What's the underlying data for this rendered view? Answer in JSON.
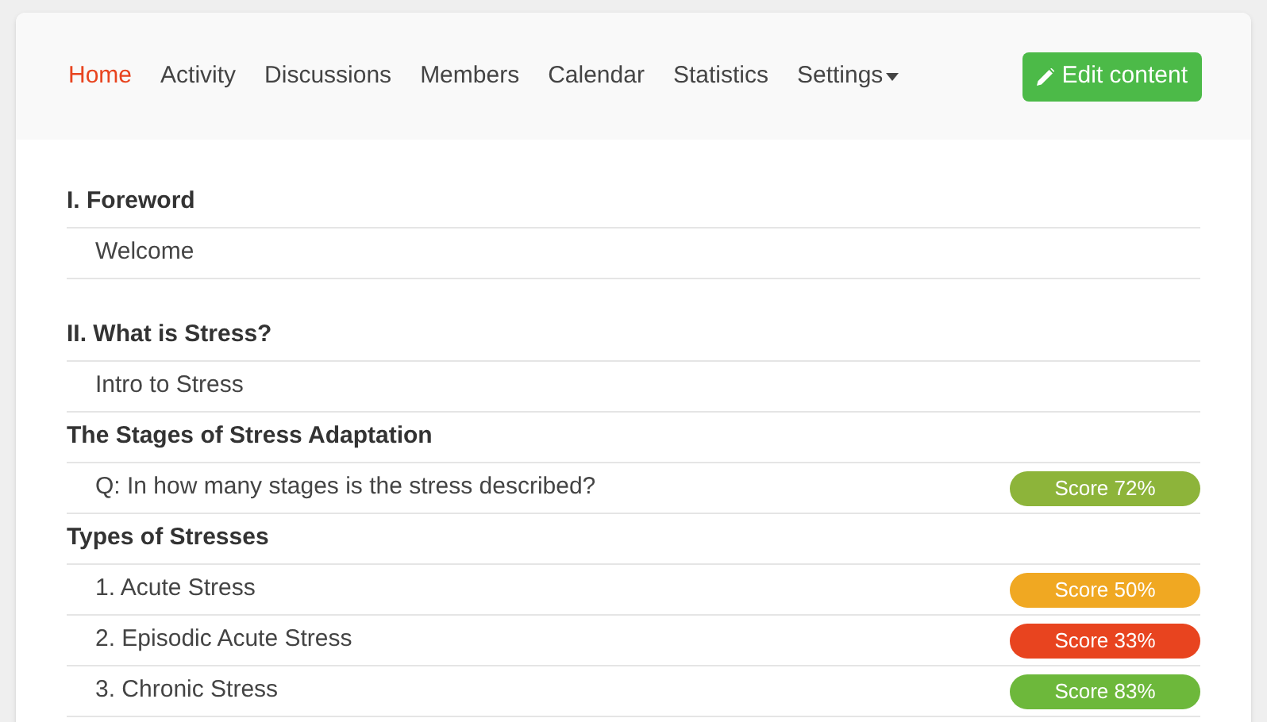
{
  "nav": {
    "items": [
      {
        "label": "Home",
        "selected": true
      },
      {
        "label": "Activity",
        "selected": false
      },
      {
        "label": "Discussions",
        "selected": false
      },
      {
        "label": "Members",
        "selected": false
      },
      {
        "label": "Calendar",
        "selected": false
      },
      {
        "label": "Statistics",
        "selected": false
      },
      {
        "label": "Settings",
        "selected": false,
        "dropdown": true
      }
    ],
    "button": "Edit content"
  },
  "chapters": [
    {
      "title": "I. Foreword",
      "lessons": [
        {
          "label": "Welcome"
        }
      ]
    },
    {
      "title": "II. What is Stress?",
      "lessons": [
        {
          "label": "Intro to Stress"
        }
      ],
      "subsections": [
        {
          "title": "The Stages of Stress Adaptation",
          "lessons": [
            {
              "label": "Q: In how many stages is the stress described?",
              "score": "Score 72%",
              "color": "#8db43a"
            }
          ]
        },
        {
          "title": "Types of Stresses",
          "lessons": [
            {
              "label": "1. Acute Stress",
              "score": "Score 50%",
              "color": "#f0a822"
            },
            {
              "label": "2. Episodic Acute Stress",
              "score": "Score 33%",
              "color": "#e8441f"
            },
            {
              "label": "3. Chronic Stress",
              "score": "Score 83%",
              "color": "#6db83b"
            }
          ]
        }
      ]
    }
  ]
}
